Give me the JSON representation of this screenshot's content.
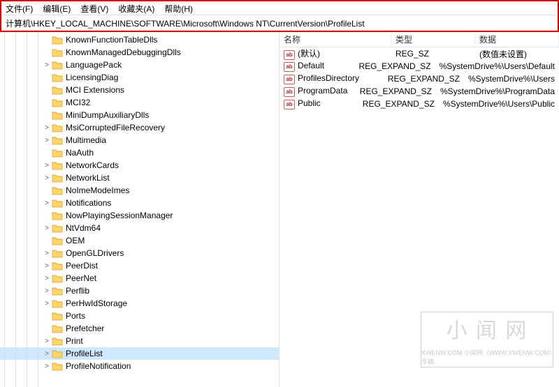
{
  "menu": {
    "file": "文件(F)",
    "edit": "编辑(E)",
    "view": "查看(V)",
    "favorites": "收藏夹(A)",
    "help": "帮助(H)"
  },
  "address": "计算机\\HKEY_LOCAL_MACHINE\\SOFTWARE\\Microsoft\\Windows NT\\CurrentVersion\\ProfileList",
  "tree": [
    {
      "label": "KnownFunctionTableDlls",
      "expander": ""
    },
    {
      "label": "KnownManagedDebuggingDlls",
      "expander": ""
    },
    {
      "label": "LanguagePack",
      "expander": ">"
    },
    {
      "label": "LicensingDiag",
      "expander": ""
    },
    {
      "label": "MCI Extensions",
      "expander": ""
    },
    {
      "label": "MCI32",
      "expander": ""
    },
    {
      "label": "MiniDumpAuxiliaryDlls",
      "expander": ""
    },
    {
      "label": "MsiCorruptedFileRecovery",
      "expander": ">"
    },
    {
      "label": "Multimedia",
      "expander": ">"
    },
    {
      "label": "NaAuth",
      "expander": ""
    },
    {
      "label": "NetworkCards",
      "expander": ">"
    },
    {
      "label": "NetworkList",
      "expander": ">"
    },
    {
      "label": "NoImeModeImes",
      "expander": ""
    },
    {
      "label": "Notifications",
      "expander": ">"
    },
    {
      "label": "NowPlayingSessionManager",
      "expander": ""
    },
    {
      "label": "NtVdm64",
      "expander": ">"
    },
    {
      "label": "OEM",
      "expander": ""
    },
    {
      "label": "OpenGLDrivers",
      "expander": ">"
    },
    {
      "label": "PeerDist",
      "expander": ">"
    },
    {
      "label": "PeerNet",
      "expander": ">"
    },
    {
      "label": "Perflib",
      "expander": ">"
    },
    {
      "label": "PerHwIdStorage",
      "expander": ">"
    },
    {
      "label": "Ports",
      "expander": ""
    },
    {
      "label": "Prefetcher",
      "expander": ""
    },
    {
      "label": "Print",
      "expander": ">"
    },
    {
      "label": "ProfileList",
      "expander": ">",
      "selected": true
    },
    {
      "label": "ProfileNotification",
      "expander": ">"
    }
  ],
  "listHeader": {
    "name": "名称",
    "type": "类型",
    "data": "数据"
  },
  "values": [
    {
      "name": "(默认)",
      "type": "REG_SZ",
      "data": "(数值未设置)"
    },
    {
      "name": "Default",
      "type": "REG_EXPAND_SZ",
      "data": "%SystemDrive%\\Users\\Default"
    },
    {
      "name": "ProfilesDirectory",
      "type": "REG_EXPAND_SZ",
      "data": "%SystemDrive%\\Users"
    },
    {
      "name": "ProgramData",
      "type": "REG_EXPAND_SZ",
      "data": "%SystemDrive%\\ProgramData"
    },
    {
      "name": "Public",
      "type": "REG_EXPAND_SZ",
      "data": "%SystemDrive%\\Users\\Public"
    }
  ],
  "valueIconText": "ab",
  "watermark": {
    "big": "小 闻 网",
    "small": "XWENW.COM            小闻网（WWW.XWENW.COM）专稿"
  }
}
